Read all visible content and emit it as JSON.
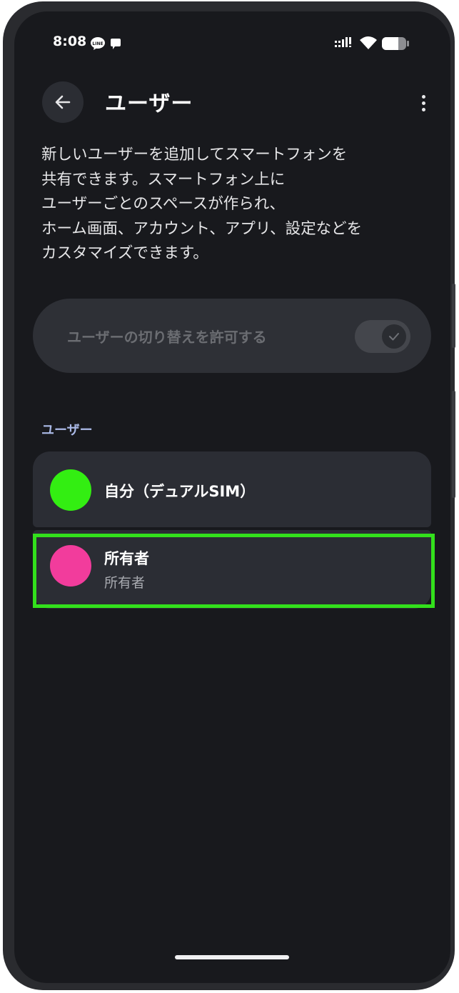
{
  "status_bar": {
    "time": "8:08",
    "icons": [
      "line-icon",
      "chat-bubble-icon",
      "signal-icon",
      "wifi-icon",
      "battery-icon"
    ]
  },
  "app_bar": {
    "title": "ユーザー",
    "back_icon": "arrow-back-icon",
    "more_icon": "more-vertical-icon"
  },
  "description_lines": [
    "新しいユーザーを追加してスマートフォンを",
    "共有できます。スマートフォン上に",
    "ユーザーごとのスペースが作られ、",
    "ホーム画面、アカウント、アプリ、設定などを",
    "カスタマイズできます。"
  ],
  "toggle": {
    "label": "ユーザーの切り替えを許可する",
    "state": "on",
    "enabled": false
  },
  "users_section": {
    "header": "ユーザー",
    "users": [
      {
        "name": "自分（デュアルSIM）",
        "avatar_color": "#33ee12"
      },
      {
        "name": "所有者",
        "subtitle": "所有者",
        "avatar_color": "#f23c9c",
        "highlighted": true
      }
    ]
  },
  "colors": {
    "background": "#18191d",
    "card": "#2b2d34",
    "accent_header": "#aab9e6",
    "highlight": "#33e01c"
  }
}
